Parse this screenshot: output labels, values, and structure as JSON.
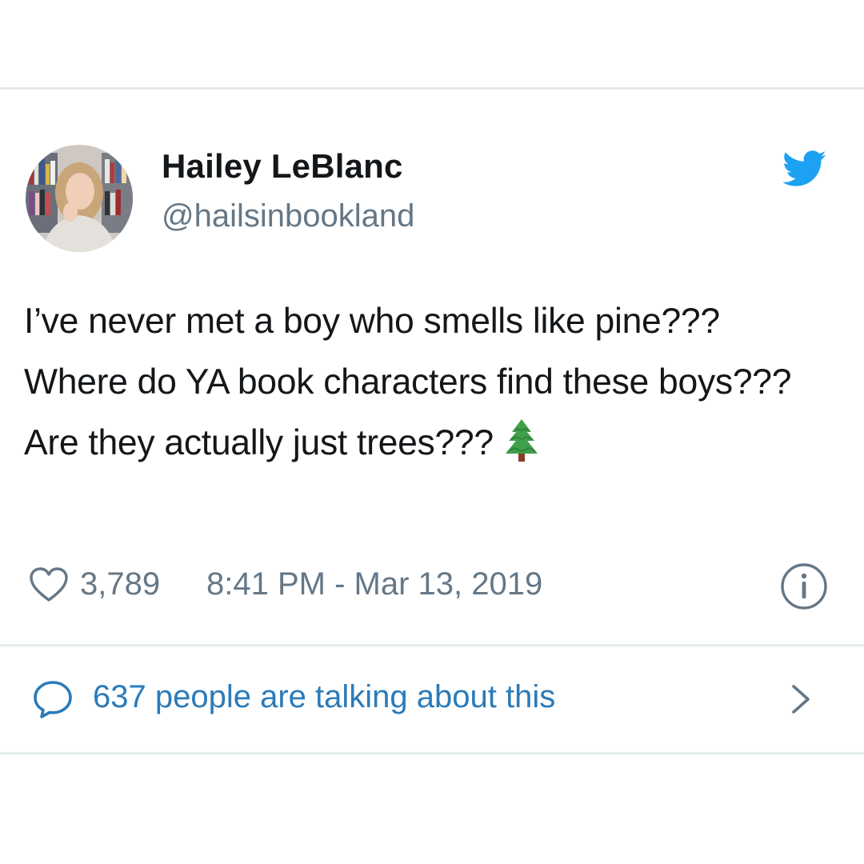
{
  "tweet": {
    "author": {
      "display_name": "Hailey LeBlanc",
      "handle": "@hailsinbookland"
    },
    "text": "I’ve never met a boy who smells like pine??? Where do YA book characters find these boys??? Are they actually just trees???",
    "emoji": "evergreen-tree",
    "likes": "3,789",
    "timestamp": "8:41 PM - Mar 13, 2019",
    "conversation": "637 people are talking about this"
  },
  "colors": {
    "twitter_blue": "#1da1f2",
    "link_blue": "#2b7bb9",
    "secondary_text": "#657786",
    "primary_text": "#14171a",
    "divider": "#e6ecf0"
  },
  "icons": {
    "brand": "twitter-bird-icon",
    "like": "heart-icon",
    "info": "info-icon",
    "reply": "speech-bubble-icon",
    "more": "chevron-right-icon"
  }
}
